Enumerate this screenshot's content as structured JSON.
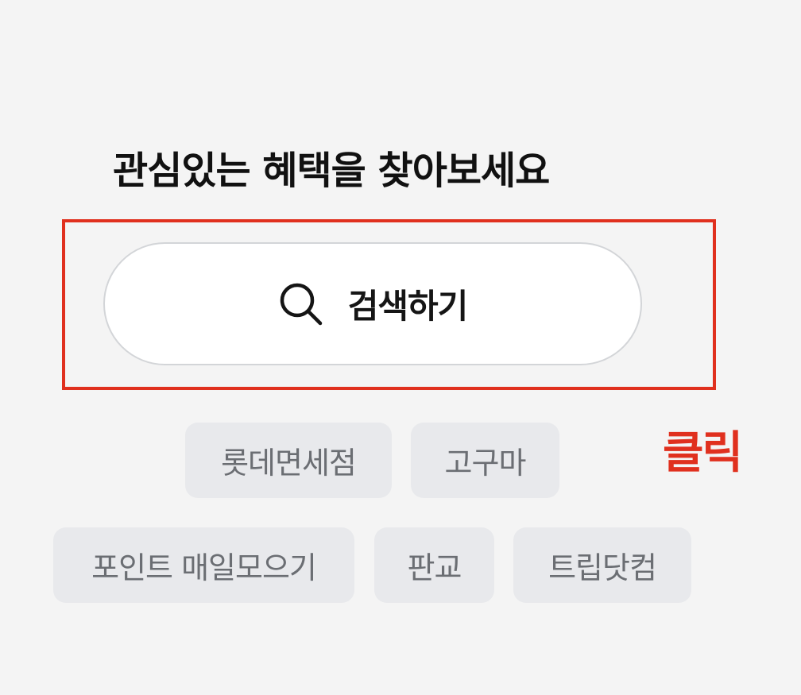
{
  "header": {
    "title": "관심있는 혜택을 찾아보세요"
  },
  "search": {
    "label": "검색하기",
    "icon": "search-icon"
  },
  "annotation": {
    "text": "클릭",
    "color": "#e0301e"
  },
  "keywords": [
    "롯데면세점",
    "고구마",
    "포인트 매일모으기",
    "판교",
    "트립닷컴"
  ]
}
